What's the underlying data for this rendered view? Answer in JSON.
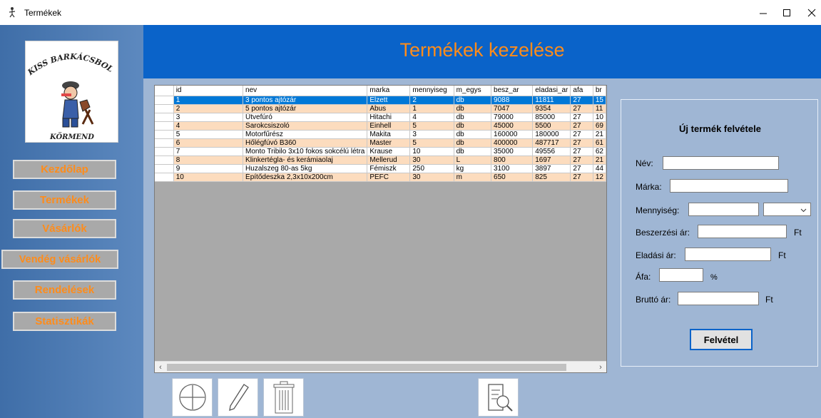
{
  "window": {
    "title": "Termékek"
  },
  "logo": {
    "top_text": "KISS BARKÁCSBOLT",
    "bottom_text": "KÖRMEND"
  },
  "nav": [
    {
      "label": "Kezdőlap"
    },
    {
      "label": "Termékek"
    },
    {
      "label": "Vásárlók"
    },
    {
      "label": "Vendég vásárlók"
    },
    {
      "label": "Rendelések"
    },
    {
      "label": "Statisztikák"
    }
  ],
  "header": {
    "title": "Termékek kezelése"
  },
  "grid": {
    "columns": [
      "id",
      "nev",
      "marka",
      "mennyiseg",
      "m_egys",
      "besz_ar",
      "eladasi_ar",
      "afa",
      "br"
    ],
    "rows": [
      [
        "1",
        "3 pontos ajtózár",
        "Elzett",
        "2",
        "db",
        "9088",
        "11811",
        "27",
        "15"
      ],
      [
        "2",
        "5 pontos ajtózár",
        "Abus",
        "1",
        "db",
        "7047",
        "9354",
        "27",
        "11"
      ],
      [
        "3",
        "Ütvefúró",
        "Hitachi",
        "4",
        "db",
        "79000",
        "85000",
        "27",
        "10"
      ],
      [
        "4",
        "Sarokcsiszoló",
        "Einhell",
        "5",
        "db",
        "45000",
        "5500",
        "27",
        "69"
      ],
      [
        "5",
        "Motorfűrész",
        "Makita",
        "3",
        "db",
        "160000",
        "180000",
        "27",
        "21"
      ],
      [
        "6",
        "Hőlégfúvó B360",
        "Master",
        "5",
        "db",
        "400000",
        "487717",
        "27",
        "61"
      ],
      [
        "7",
        "Monto Tribilo 3x10 fokos sokcélú létra",
        "Krause",
        "10",
        "db",
        "35000",
        "49556",
        "27",
        "62"
      ],
      [
        "8",
        "Klinkertégla- és kerámiaolaj",
        "Mellerud",
        "30",
        "L",
        "800",
        "1697",
        "27",
        "21"
      ],
      [
        "9",
        "Huzalszeg 80-as 5kg",
        "Fémiszk",
        "250",
        "kg",
        "3100",
        "3897",
        "27",
        "44"
      ],
      [
        "10",
        "Építődeszka 2,3x10x200cm",
        "PEFC",
        "30",
        "m",
        "650",
        "825",
        "27",
        "12"
      ]
    ],
    "selected_row_marker": "▷"
  },
  "toolbar": [
    {
      "icon": "add-circle-icon"
    },
    {
      "icon": "pencil-icon"
    },
    {
      "icon": "trash-icon"
    },
    {
      "icon": "document-search-icon"
    }
  ],
  "form": {
    "title": "Új termék felvétele",
    "name_label": "Név:",
    "brand_label": "Márka:",
    "qty_label": "Mennyiség:",
    "buy_price_label": "Beszerzési ár:",
    "sell_price_label": "Eladási ár:",
    "vat_label": "Áfa:",
    "gross_label": "Bruttó ár:",
    "ft": "Ft",
    "percent": "%",
    "submit_label": "Felvétel"
  },
  "colors": {
    "accent": "#ff8c1a",
    "header_bg": "#0a63c9",
    "selection": "#0078d7",
    "row_alt": "#fcdcbe"
  }
}
